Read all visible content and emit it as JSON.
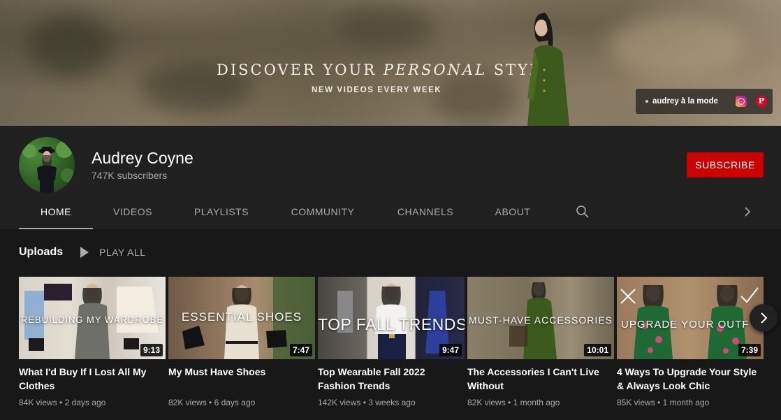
{
  "banner": {
    "title_part1": "DISCOVER YOUR ",
    "title_italic": "PERSONAL",
    "title_part2": " STYLE",
    "subtitle": "NEW VIDEOS EVERY WEEK",
    "link_label": "audrey à la mode",
    "link_icons": [
      "instagram-icon",
      "pinterest-icon"
    ]
  },
  "channel": {
    "name": "Audrey Coyne",
    "subscribers": "747K subscribers",
    "subscribe_label": "SUBSCRIBE",
    "subscribe_color": "#cc0000"
  },
  "tabs": [
    {
      "label": "HOME",
      "active": true
    },
    {
      "label": "VIDEOS",
      "active": false
    },
    {
      "label": "PLAYLISTS",
      "active": false
    },
    {
      "label": "COMMUNITY",
      "active": false
    },
    {
      "label": "CHANNELS",
      "active": false
    },
    {
      "label": "ABOUT",
      "active": false
    }
  ],
  "uploads": {
    "title": "Uploads",
    "play_all": "PLAY ALL",
    "videos": [
      {
        "thumb_text": "REBUILDING MY WARDROBE",
        "duration": "9:13",
        "title": "What I'd Buy If I Lost All My Clothes",
        "views": "84K views",
        "age": "2 days ago"
      },
      {
        "thumb_text": "ESSENTIAL SHOES",
        "duration": "7:47",
        "title": "My Must Have Shoes",
        "views": "82K views",
        "age": "6 days ago"
      },
      {
        "thumb_text": "TOP FALL TRENDS",
        "duration": "9:47",
        "title": "Top Wearable Fall 2022 Fashion Trends",
        "views": "142K views",
        "age": "3 weeks ago"
      },
      {
        "thumb_text": "MUST-HAVE ACCESSORIES",
        "duration": "10:01",
        "title": "The Accessories I Can't Live Without",
        "views": "82K views",
        "age": "1 month ago"
      },
      {
        "thumb_text": "UPGRADE YOUR OUTF",
        "duration": "7:39",
        "title": "4 Ways To Upgrade Your Style & Always Look Chic",
        "views": "85K views",
        "age": "1 month ago"
      }
    ]
  },
  "colors": {
    "page_bg": "#181818",
    "header_bg": "#202020",
    "muted_text": "#aaaaaa",
    "accent_red": "#cc0000"
  }
}
